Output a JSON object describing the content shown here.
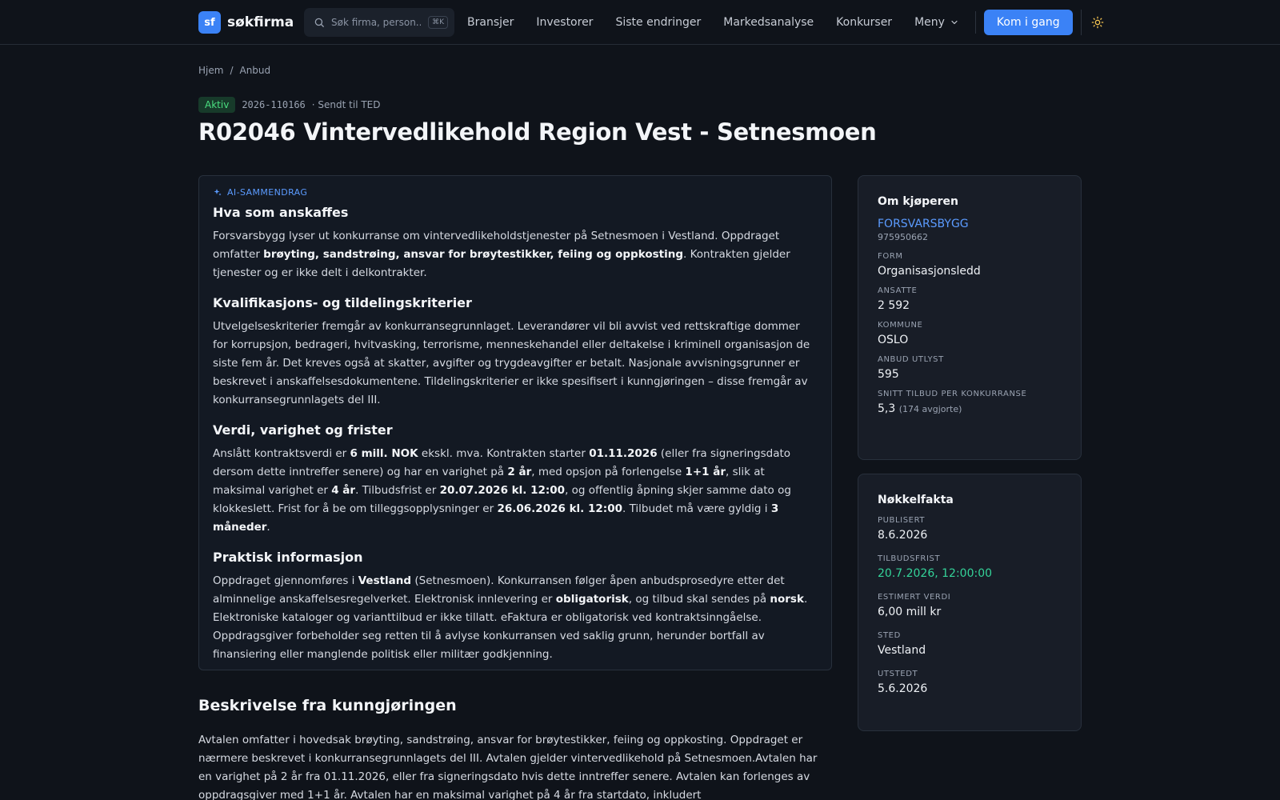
{
  "brand": {
    "mark": "sf",
    "name": "søkfirma",
    "accent": "#3b82f6"
  },
  "search": {
    "placeholder": "Søk firma, person...",
    "shortcut": "⌘K"
  },
  "nav": {
    "items": [
      "Bransjer",
      "Investorer",
      "Siste endringer",
      "Markedsanalyse",
      "Konkurser"
    ],
    "menu_label": "Meny",
    "cta_label": "Kom i gang"
  },
  "breadcrumb": {
    "home": "Hjem",
    "separator": "/",
    "current": "Anbud"
  },
  "notice": {
    "status": "Aktiv",
    "id": "2026-110166",
    "sent": "· Sendt til TED",
    "title": "R02046 Vintervedlikehold Region Vest - Setnesmoen"
  },
  "summary": {
    "tag": "AI-SAMMENDRAG",
    "sections": [
      {
        "heading": "Hva som anskaffes",
        "parts": [
          [
            "Forsvarsbygg lyser ut konkurranse om vintervedlikeholdstjenester på Setnesmoen i Vestland. Oppdraget omfatter ",
            false
          ],
          [
            "brøyting, sandstrøing, ansvar for brøytestikker, feiing og oppkosting",
            true
          ],
          [
            ". Kontrakten gjelder tjenester og er ikke delt i delkontrakter.",
            false
          ]
        ]
      },
      {
        "heading": "Kvalifikasjons- og tildelingskriterier",
        "parts": [
          [
            "Utvelgelseskriterier fremgår av konkurransegrunnlaget. Leverandører vil bli avvist ved rettskraftige dommer for korrupsjon, bedrageri, hvitvasking, terrorisme, menneskehandel eller deltakelse i kriminell organisasjon de siste fem år. Det kreves også at skatter, avgifter og trygdeavgifter er betalt. Nasjonale avvisningsgrunner er beskrevet i anskaffelsesdokumentene. Tildelingskriterier er ikke spesifisert i kunngjøringen – disse fremgår av konkurransegrunnlagets del III.",
            false
          ]
        ]
      },
      {
        "heading": "Verdi, varighet og frister",
        "parts": [
          [
            "Anslått kontraktsverdi er ",
            false
          ],
          [
            "6 mill. NOK",
            true
          ],
          [
            " ekskl. mva. Kontrakten starter ",
            false
          ],
          [
            "01.11.2026",
            true
          ],
          [
            " (eller fra signeringsdato dersom dette inntreffer senere) og har en varighet på ",
            false
          ],
          [
            "2 år",
            true
          ],
          [
            ", med opsjon på forlengelse ",
            false
          ],
          [
            "1+1 år",
            true
          ],
          [
            ", slik at maksimal varighet er ",
            false
          ],
          [
            "4 år",
            true
          ],
          [
            ". Tilbudsfrist er ",
            false
          ],
          [
            "20.07.2026 kl. 12:00",
            true
          ],
          [
            ", og offentlig åpning skjer samme dato og klokkeslett. Frist for å be om tilleggsopplysninger er ",
            false
          ],
          [
            "26.06.2026 kl. 12:00",
            true
          ],
          [
            ". Tilbudet må være gyldig i ",
            false
          ],
          [
            "3 måneder",
            true
          ],
          [
            ".",
            false
          ]
        ]
      },
      {
        "heading": "Praktisk informasjon",
        "parts": [
          [
            "Oppdraget gjennomføres i ",
            false
          ],
          [
            "Vestland",
            true
          ],
          [
            " (Setnesmoen). Konkurransen følger åpen anbudsprosedyre etter det alminnelige anskaffelsesregelverket. Elektronisk innlevering er ",
            false
          ],
          [
            "obligatorisk",
            true
          ],
          [
            ", og tilbud skal sendes på ",
            false
          ],
          [
            "norsk",
            true
          ],
          [
            ". Elektroniske kataloger og varianttilbud er ikke tillatt. eFaktura er obligatorisk ved kontraktsinngåelse. Oppdragsgiver forbeholder seg retten til å avlyse konkurransen ved saklig grunn, herunder bortfall av finansiering eller manglende politisk eller militær godkjenning.",
            false
          ]
        ]
      }
    ]
  },
  "buyer": {
    "title": "Om kjøperen",
    "name": "FORSVARSBYGG",
    "org_no": "975950662",
    "fields": [
      {
        "label": "FORM",
        "value": "Organisasjonsledd",
        "sub": ""
      },
      {
        "label": "ANSATTE",
        "value": "2 592",
        "sub": ""
      },
      {
        "label": "KOMMUNE",
        "value": "OSLO",
        "sub": ""
      },
      {
        "label": "ANBUD UTLYST",
        "value": "595",
        "sub": ""
      },
      {
        "label": "SNITT TILBUD PER KONKURRANSE",
        "value": "5,3",
        "sub": "(174 avgjorte)"
      }
    ]
  },
  "facts": {
    "title": "Nøkkelfakta",
    "fields": [
      {
        "label": "PUBLISERT",
        "value": "8.6.2026",
        "highlight": false
      },
      {
        "label": "TILBUDSFRIST",
        "value": "20.7.2026, 12:00:00",
        "highlight": true
      },
      {
        "label": "ESTIMERT VERDI",
        "value": "6,00 mill kr",
        "highlight": false
      },
      {
        "label": "STED",
        "value": "Vestland",
        "highlight": false
      },
      {
        "label": "UTSTEDT",
        "value": "5.6.2026",
        "highlight": false
      }
    ],
    "highlight_color": "#34d399"
  },
  "description": {
    "title": "Beskrivelse fra kunngjøringen",
    "text": "Avtalen omfatter i hovedsak brøyting, sandstrøing, ansvar for brøytestikker, feiing og oppkosting. Oppdraget er nærmere beskrevet i konkurransegrunnlagets del III. Avtalen gjelder vintervedlikehold på Setnesmoen.Avtalen har en varighet på 2 år fra 01.11.2026, eller fra signeringsdato hvis dette inntreffer senere. Avtalen kan forlenges av oppdragsgiver med 1+1 år. Avtalen har en maksimal varighet på 4 år fra startdato, inkludert forlengelser.Oppdragsgiver forbeholder seg retten til å"
  }
}
